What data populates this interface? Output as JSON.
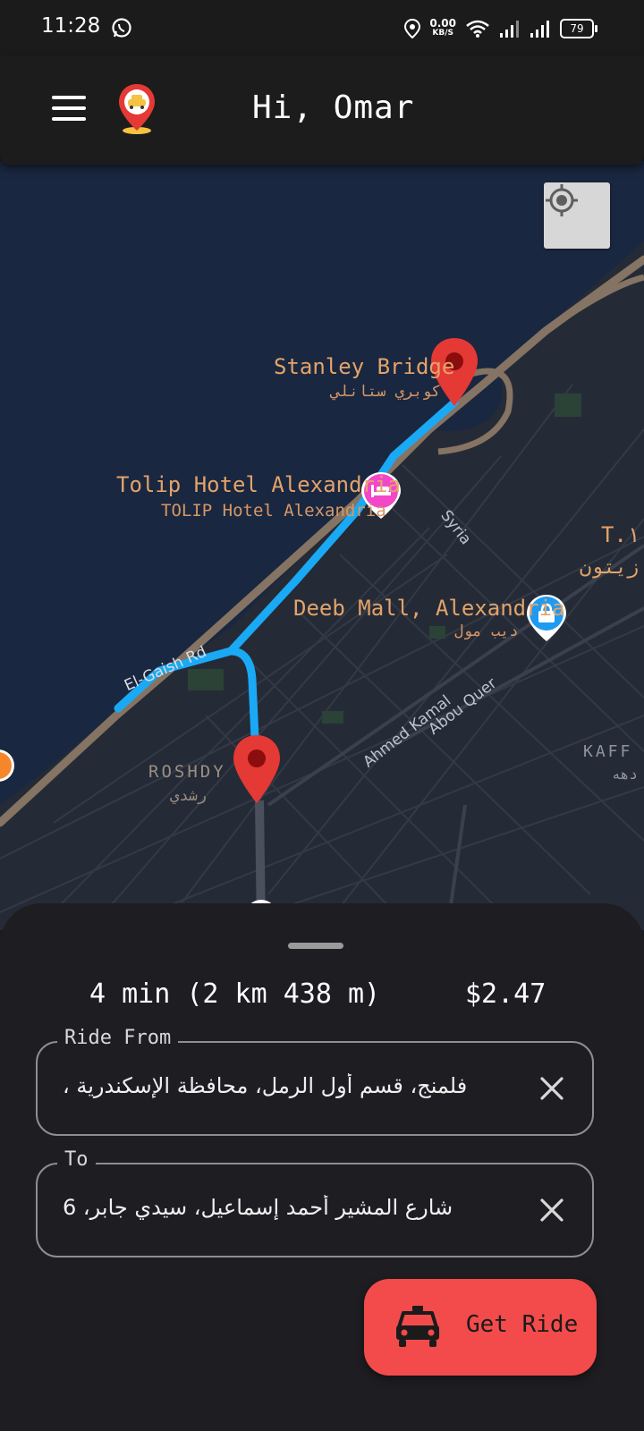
{
  "status_bar": {
    "time": "11:28",
    "speed_value": "0.00",
    "speed_unit": "KB/S",
    "battery": "79",
    "icons": [
      "whatsapp-icon",
      "location-icon",
      "wifi-icon",
      "signal-icon",
      "signal-icon",
      "battery-icon"
    ]
  },
  "header": {
    "menu_icon": "hamburger-menu-icon",
    "logo_icon": "taxi-pin-logo-icon",
    "greeting": "Hi, Omar"
  },
  "map": {
    "labels": {
      "stanley_en": "Stanley Bridge",
      "stanley_ar": "كوبري ستانلي",
      "tolip_en": "Tolip Hotel Alexandria",
      "tolip_sub": "TOLIP Hotel Alexandria",
      "deeb_en": "Deeb Mall, Alexandria",
      "deeb_ar": "ديب مول",
      "roshdy_en": "ROSHDY",
      "roshdy_ar": "رشدي",
      "ty_partial": "T.١",
      "zaytoun_partial": "زيتون",
      "kafr_partial": "KAFF",
      "kafr_ar_partial": "دهه"
    },
    "roads": {
      "el_gaish": "El-Gaish Rd",
      "syria": "Syria",
      "ahmed_kamal": "Ahmed Kamal",
      "abou_quer": "Abou Quer"
    },
    "locate_icon": "my-location-icon",
    "colors": {
      "route": "#1aa9f5",
      "pin": "#e53935",
      "hotel": "#f247c9",
      "mall": "#1e9af2",
      "coast_road": "#857463"
    }
  },
  "sheet": {
    "eta": "4 min (2 km 438 m)",
    "price": "$2.47",
    "from": {
      "label": "Ride From",
      "value": "فلمنج، قسم أول الرمل، محافظة الإسكندرية ،"
    },
    "to": {
      "label": "To",
      "value": "شارع المشير أحمد إسماعيل، سيدي جابر، 6"
    },
    "get_ride_label": "Get Ride",
    "accent": "#f34b4b"
  }
}
